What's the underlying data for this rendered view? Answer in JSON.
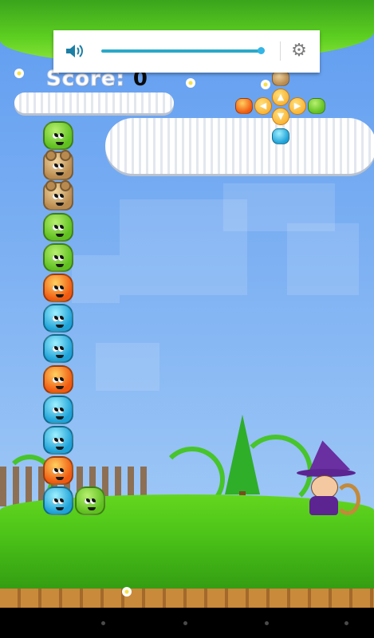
{
  "hud": {
    "score_label": "Score:",
    "score_value": "0"
  },
  "volume_overlay": {
    "icon": "speaker-icon",
    "level": 1.0,
    "settings_icon": "gear-icon",
    "settings_glyph": "⚙"
  },
  "board": {
    "column_left": [
      "green",
      "tan",
      "tan",
      "green",
      "green",
      "orange",
      "blue",
      "blue",
      "orange",
      "blue",
      "blue",
      "orange",
      "blue"
    ],
    "bottom_extra": [
      "green"
    ],
    "next_preview": [
      "tan",
      "orange",
      "green",
      "blue"
    ]
  },
  "controls": {
    "up": "▲",
    "down": "▼",
    "left": "◀",
    "right": "▶"
  },
  "colors": {
    "green": "#5fc020",
    "tan": "#b98a4f",
    "orange": "#f05a10",
    "blue": "#1ea2d8",
    "accent": "#33b5e5"
  }
}
